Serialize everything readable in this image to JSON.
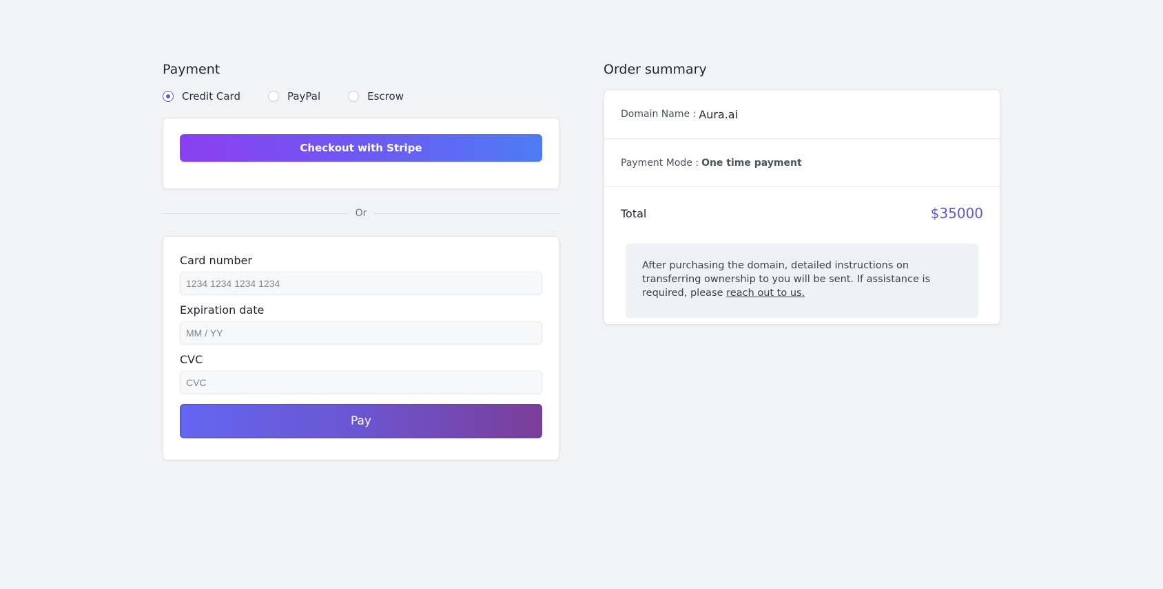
{
  "payment": {
    "title": "Payment",
    "methods": [
      {
        "label": "Credit Card",
        "selected": true
      },
      {
        "label": "PayPal",
        "selected": false
      },
      {
        "label": "Escrow",
        "selected": false
      }
    ],
    "stripe_button": "Checkout with Stripe",
    "divider_text": "Or",
    "card_number": {
      "label": "Card number",
      "placeholder": "1234 1234 1234 1234",
      "value": ""
    },
    "expiration": {
      "label": "Expiration date",
      "placeholder": "MM / YY",
      "value": ""
    },
    "cvc": {
      "label": "CVC",
      "placeholder": "CVC",
      "value": ""
    },
    "pay_button": "Pay"
  },
  "summary": {
    "title": "Order summary",
    "domain_label": "Domain Name :",
    "domain_value": "Aura.ai",
    "mode_label": "Payment Mode :",
    "mode_value": "One time payment",
    "total_label": "Total",
    "total_value": "$35000",
    "notice_text": "After purchasing the domain, detailed instructions on transferring ownership to you will be sent. If assistance is required, please",
    "notice_link": "reach out to us."
  },
  "colors": {
    "accent": "#5b5bd6",
    "background": "#f2f3f5",
    "notice_bg": "#eef2f6"
  }
}
